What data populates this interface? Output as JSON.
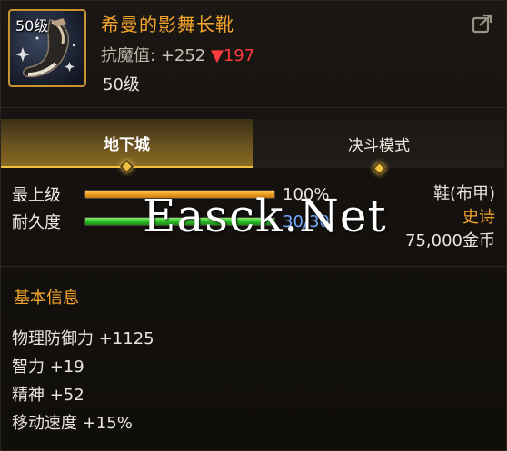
{
  "item": {
    "level_badge": "50级",
    "name": "希曼的影舞长靴",
    "stat_label": "抗魔值:",
    "stat_value": "+252",
    "stat_change_arrow": "▼",
    "stat_change": "197",
    "required_level": "50级",
    "icon": "boot-icon"
  },
  "header": {
    "share_icon": "share-icon"
  },
  "tabs": [
    {
      "label": "地下城",
      "active": true
    },
    {
      "label": "决斗模式",
      "active": false
    }
  ],
  "bars": [
    {
      "label": "最上级",
      "value_text": "100%",
      "fill": 1.0,
      "color": "orange"
    },
    {
      "label": "耐久度",
      "value_text": "30/30",
      "fill": 1.0,
      "color": "green"
    }
  ],
  "info": {
    "type": "鞋(布甲)",
    "rarity": "史诗",
    "price": "75,000金币"
  },
  "watermark": "Easck.Net",
  "section": {
    "title": "基本信息"
  },
  "attributes": [
    "物理防御力 +1125",
    "智力 +19",
    "精神 +52",
    "移动速度 +15%"
  ],
  "colors": {
    "accent_gold": "#f4a42c",
    "decrease_red": "#ff3b3b",
    "durability_blue": "#6fa8ff"
  }
}
